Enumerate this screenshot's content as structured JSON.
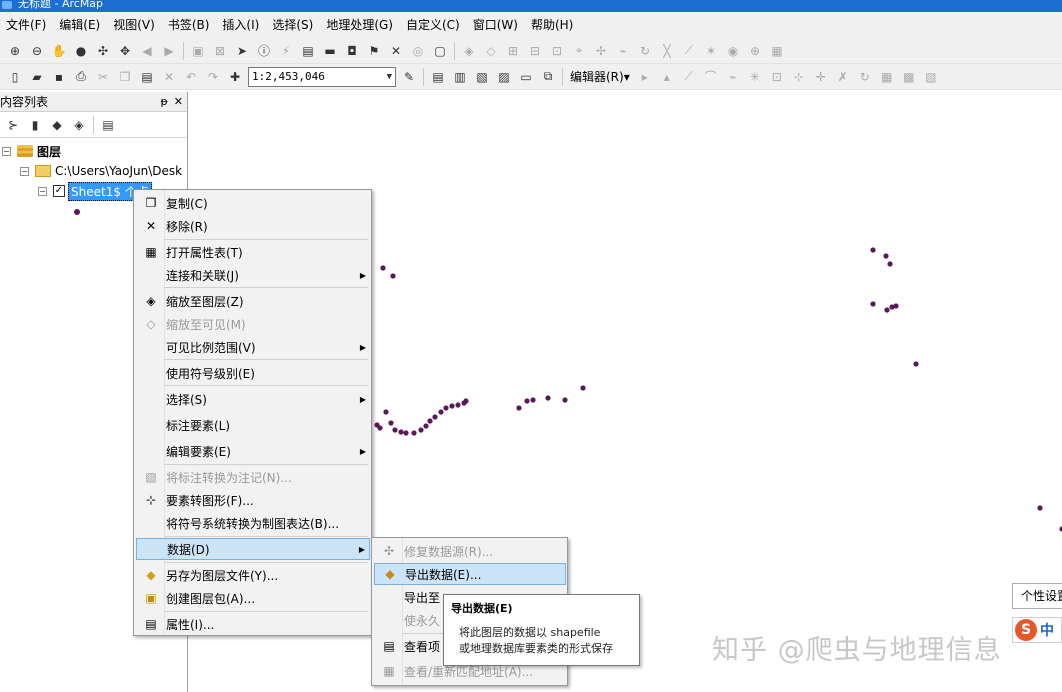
{
  "window": {
    "title": "无标题 - ArcMap"
  },
  "menubar": [
    "文件(F)",
    "编辑(E)",
    "视图(V)",
    "书签(B)",
    "插入(I)",
    "选择(S)",
    "地理处理(G)",
    "自定义(C)",
    "窗口(W)",
    "帮助(H)"
  ],
  "toolbar": {
    "scale": "1:2,453,046",
    "editor_label": "编辑器(R)▾"
  },
  "toc": {
    "title": "内容列表",
    "pin": "ᵽ",
    "close": "✕",
    "root_label": "图层",
    "folder_label": "C:\\Users\\YaoJun\\Desk",
    "layer_label": "Sheet1$ 个点"
  },
  "context_menu": [
    {
      "label": "复制(C)",
      "icon": "copy-icon",
      "disabled": false,
      "submenu": false
    },
    {
      "label": "移除(R)",
      "icon": "remove-icon",
      "disabled": false,
      "submenu": false
    },
    {
      "label": "打开属性表(T)",
      "icon": "table-icon",
      "disabled": false,
      "submenu": false
    },
    {
      "label": "连接和关联(J)",
      "icon": "",
      "disabled": false,
      "submenu": true
    },
    {
      "label": "缩放至图层(Z)",
      "icon": "zoom-layer-icon",
      "disabled": false,
      "submenu": false
    },
    {
      "label": "缩放至可见(M)",
      "icon": "zoom-visible-icon",
      "disabled": true,
      "submenu": false
    },
    {
      "label": "可见比例范围(V)",
      "icon": "",
      "disabled": false,
      "submenu": true
    },
    {
      "label": "使用符号级别(E)",
      "icon": "",
      "disabled": false,
      "submenu": false
    },
    {
      "label": "选择(S)",
      "icon": "",
      "disabled": false,
      "submenu": true
    },
    {
      "label": "标注要素(L)",
      "icon": "",
      "disabled": false,
      "submenu": false
    },
    {
      "label": "编辑要素(E)",
      "icon": "",
      "disabled": false,
      "submenu": true
    },
    {
      "label": "将标注转换为注记(N)...",
      "icon": "convert-labels-icon",
      "disabled": true,
      "submenu": false
    },
    {
      "label": "要素转图形(F)...",
      "icon": "features-to-graphics-icon",
      "disabled": false,
      "submenu": false
    },
    {
      "label": "将符号系统转换为制图表达(B)...",
      "icon": "",
      "disabled": false,
      "submenu": false
    },
    {
      "label": "数据(D)",
      "icon": "",
      "disabled": false,
      "submenu": true,
      "highlight": true
    },
    {
      "label": "另存为图层文件(Y)...",
      "icon": "layer-file-icon",
      "disabled": false,
      "submenu": false
    },
    {
      "label": "创建图层包(A)...",
      "icon": "layer-package-icon",
      "disabled": false,
      "submenu": false
    },
    {
      "label": "属性(I)...",
      "icon": "properties-icon",
      "disabled": false,
      "submenu": false
    }
  ],
  "submenu": [
    {
      "label": "修复数据源(R)...",
      "disabled": true,
      "icon": "repair-icon"
    },
    {
      "label": "导出数据(E)...",
      "disabled": false,
      "icon": "export-data-icon",
      "highlight": true
    },
    {
      "label": "导出至",
      "disabled": false,
      "icon": ""
    },
    {
      "label": "使永久",
      "disabled": true,
      "icon": ""
    },
    {
      "label": "查看项",
      "disabled": false,
      "icon": "view-item-icon"
    },
    {
      "label": "查看/重新匹配地址(A)...",
      "disabled": true,
      "icon": "rematch-icon"
    }
  ],
  "tooltip": {
    "title": "导出数据(E)",
    "line1": "将此图层的数据以 shapefile",
    "line2": "或地理数据库要素类的形式保存"
  },
  "watermark": "知乎 @爬虫与地理信息",
  "ime": {
    "tip": "个性设置",
    "logo": "S",
    "text": "中"
  },
  "map": {
    "point_color": "#5a1a5a",
    "points_note": "scattered point features"
  }
}
